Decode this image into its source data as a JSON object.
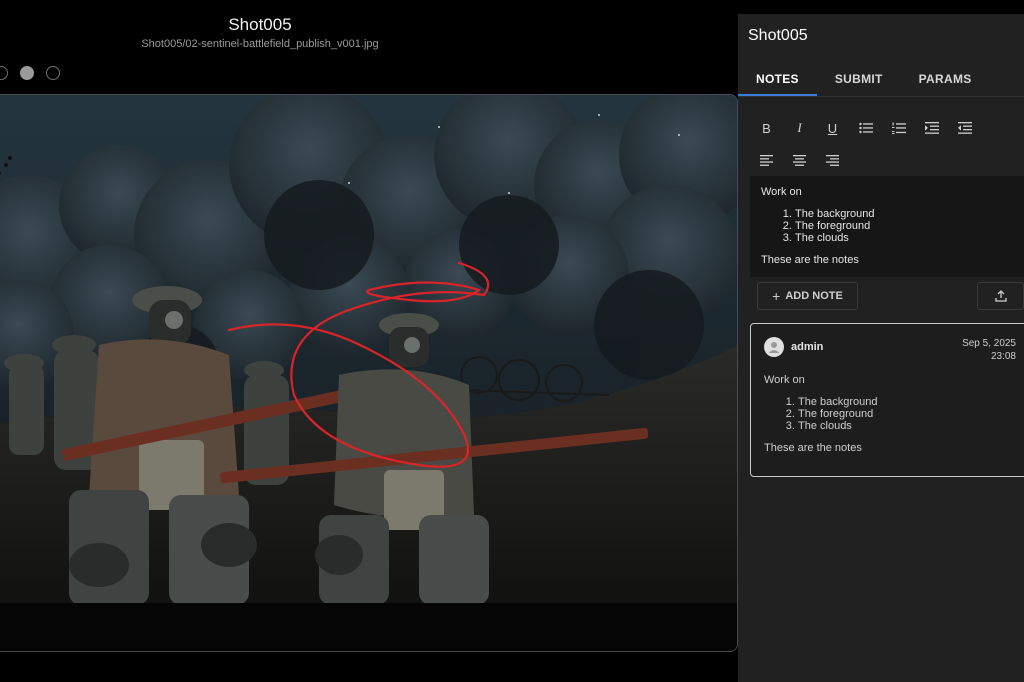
{
  "viewer": {
    "title": "Shot005",
    "file_path": "Shot005/02-sentinel-battlefield_publish_v001.jpg",
    "version_dots": [
      {
        "active": false
      },
      {
        "active": true
      },
      {
        "active": false
      }
    ]
  },
  "panel": {
    "title": "Shot005",
    "tabs": [
      {
        "label": "NOTES",
        "active": true
      },
      {
        "label": "SUBMIT",
        "active": false
      },
      {
        "label": "PARAMS",
        "active": false
      }
    ],
    "toolbar": {
      "row1": [
        "bold-icon",
        "italic-icon",
        "underline-icon",
        "bulleted-list-icon",
        "numbered-list-icon",
        "indent-icon",
        "outdent-icon"
      ],
      "row2": [
        "align-left-icon",
        "align-center-icon",
        "align-right-icon"
      ],
      "bold_glyph": "B",
      "italic_glyph": "I",
      "underline_glyph": "U"
    },
    "editor": {
      "intro": "Work on",
      "items": [
        "The background",
        "The foreground",
        "The clouds"
      ],
      "outro": "These are the notes"
    },
    "add_note_label": "ADD NOTE",
    "note_card": {
      "user": "admin",
      "date": "Sep 5, 2025",
      "time": "23:08",
      "intro": "Work on",
      "items": [
        "The background",
        "The foreground",
        "The clouds"
      ],
      "outro": "These are the notes"
    }
  },
  "colors": {
    "accent": "#3d7bd8",
    "annotation": "#d8242a",
    "panel_bg": "#212121"
  }
}
